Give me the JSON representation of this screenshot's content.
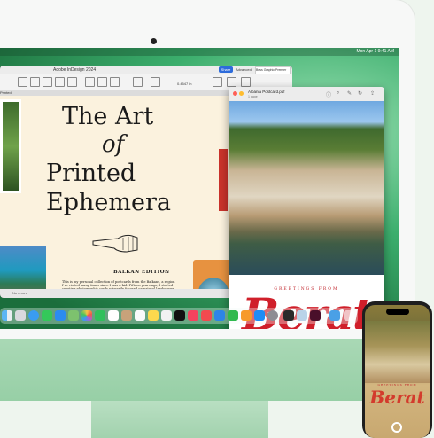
{
  "menubar": {
    "clock": "Mon Apr 1  9:41 AM"
  },
  "indesign": {
    "window_title": "Adobe InDesign 2024",
    "share_label": "Share",
    "advanced_label": "Advanced",
    "font_field": "Bess Graphic Premier",
    "zoom_value": "0.4547 in",
    "doc_tab": "Printed",
    "status_text": "No errors",
    "page": {
      "title_line1": "The Art",
      "title_line2": "of",
      "title_line3": "Printed",
      "title_line4": "Ephemera",
      "edition": "BALKAN EDITION",
      "body": "This is my personal collection of postcards from the Balkans, a region I've visited many times since I was a kid. Fifteen years ago, I started curating photographic cards primarily focused on natural landscapes, historical sites, and cultural aesthetics."
    }
  },
  "preview": {
    "filename": "Albania Postcard.pdf",
    "subtitle": "1 page",
    "greeting": "GREETINGS FROM",
    "city": "Berat"
  },
  "dock": {
    "apps": [
      "finder-icon",
      "launchpad-icon",
      "safari-icon",
      "messages-icon",
      "mail-icon",
      "maps-icon",
      "photos-icon",
      "facetime-icon",
      "calendar-icon",
      "contacts-icon",
      "reminders-icon",
      "notes-icon",
      "freeform-icon",
      "tv-icon",
      "music-icon",
      "news-icon",
      "keynote-icon",
      "numbers-icon",
      "pages-icon",
      "app-store-icon",
      "settings-icon",
      "iphone-mirroring-icon",
      "preview-icon",
      "indesign-icon",
      "downloads-icon",
      "trash-icon"
    ]
  },
  "iphone": {
    "greeting": "GREETINGS FROM",
    "city": "Berat"
  },
  "colors": {
    "accent": "#2d6bdb",
    "postcard_red": "#d01f2a",
    "imac_green": "#a9d8b5"
  }
}
